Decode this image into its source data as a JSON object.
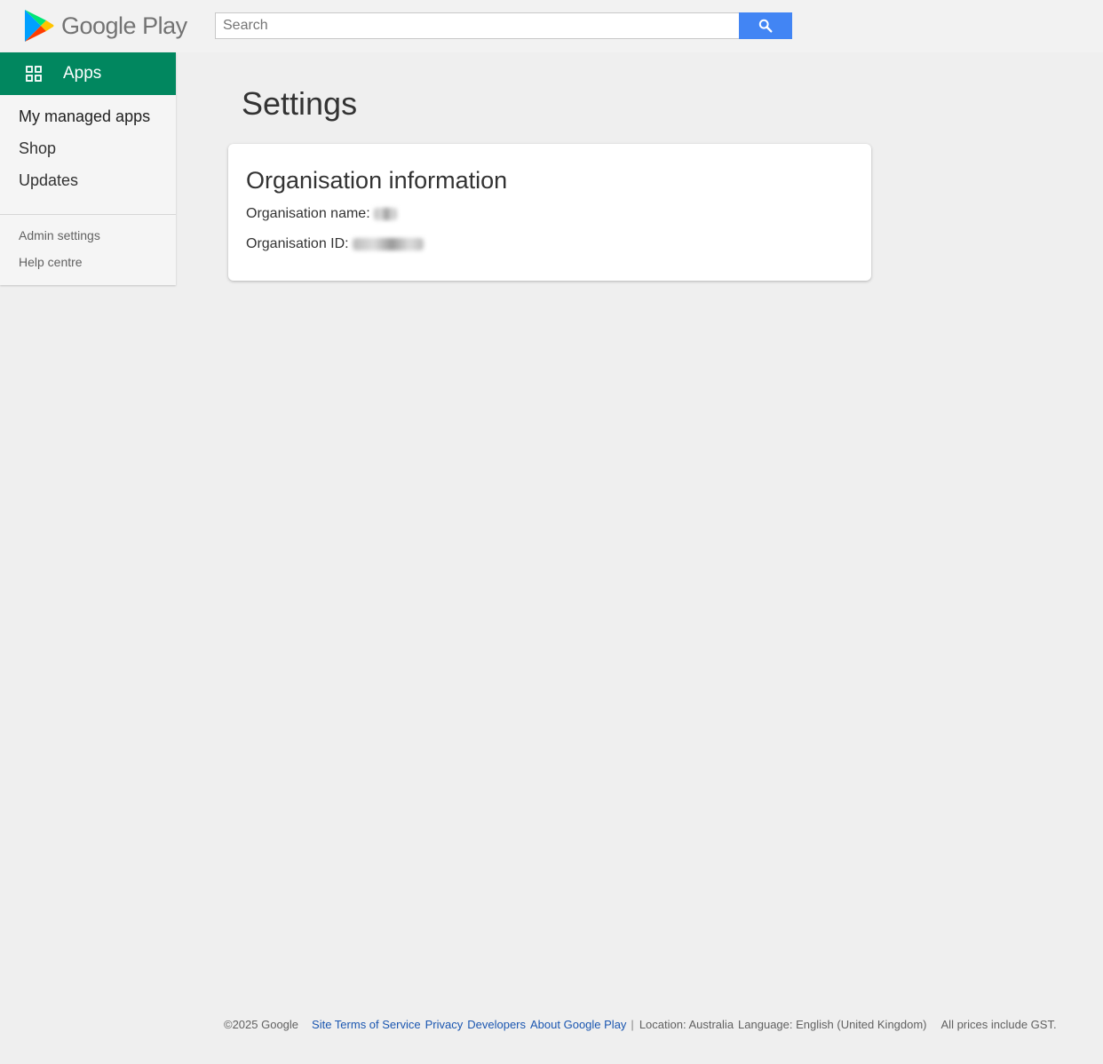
{
  "header": {
    "logo_text": "Google Play",
    "search": {
      "placeholder": "Search",
      "value": ""
    },
    "search_button_icon": "search-icon"
  },
  "sidebar": {
    "apps_tab": {
      "label": "Apps",
      "icon": "apps-grid-icon"
    },
    "nav_items": [
      {
        "label": "My managed apps"
      },
      {
        "label": "Shop"
      },
      {
        "label": "Updates"
      }
    ],
    "sub_items": [
      {
        "label": "Admin settings"
      },
      {
        "label": "Help centre"
      }
    ]
  },
  "main": {
    "page_title": "Settings",
    "card": {
      "title": "Organisation information",
      "org_name_label": "Organisation name:",
      "org_id_label": "Organisation ID:"
    }
  },
  "footer": {
    "copyright": "©2025 Google",
    "links": [
      "Site Terms of Service",
      "Privacy",
      "Developers",
      "About Google Play"
    ],
    "separator": "|",
    "location": "Location: Australia",
    "language": "Language: English (United Kingdom)",
    "prices_note": "All prices include GST."
  },
  "colors": {
    "apps_tab": "#01875f",
    "search_button": "#4285f4",
    "link": "#1a56b0",
    "background": "#efefef"
  }
}
